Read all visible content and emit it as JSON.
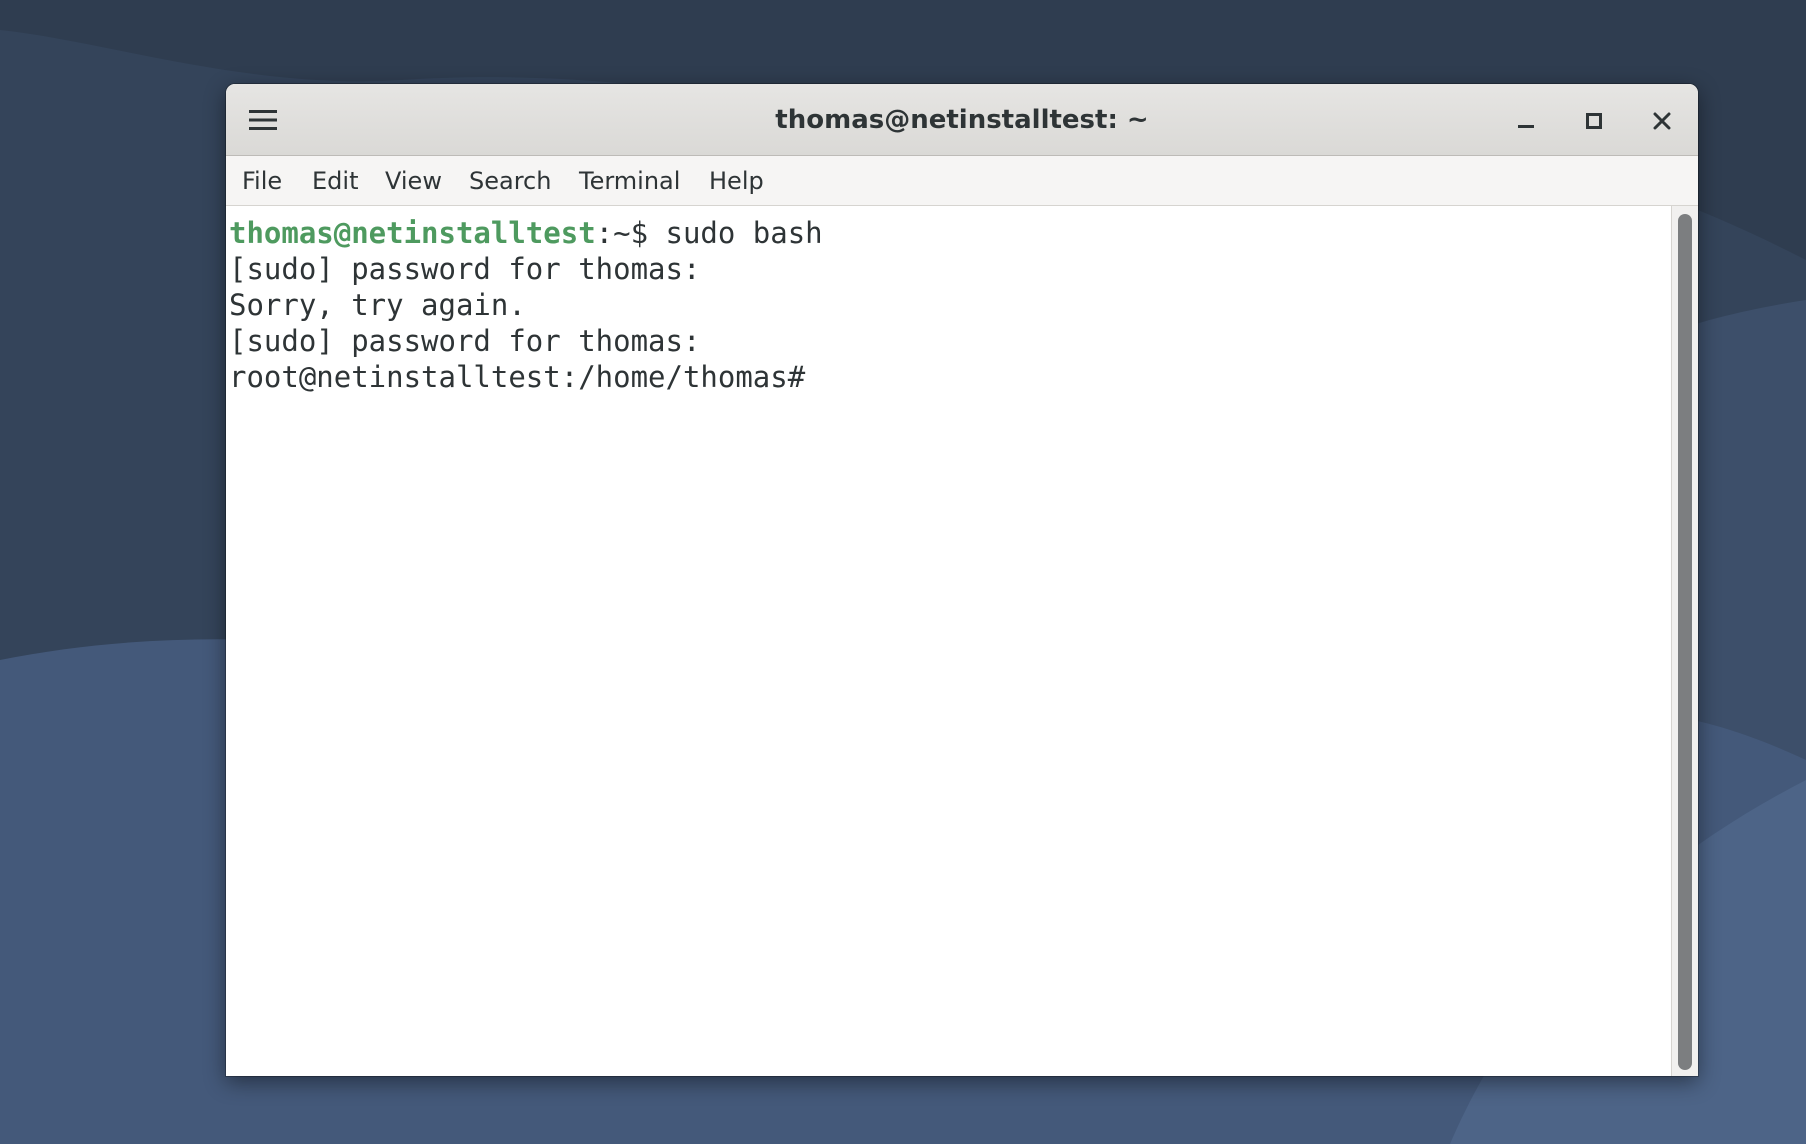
{
  "window": {
    "title": "thomas@netinstalltest: ~"
  },
  "menu": {
    "items": [
      "File",
      "Edit",
      "View",
      "Search",
      "Terminal",
      "Help"
    ]
  },
  "terminal": {
    "prompt_user_host": "thomas@netinstalltest",
    "prompt_suffix": ":~$ ",
    "command": "sudo bash",
    "lines": [
      "[sudo] password for thomas:",
      "Sorry, try again.",
      "[sudo] password for thomas:",
      "root@netinstalltest:/home/thomas#"
    ]
  },
  "colors": {
    "desktop_background": "#34445a",
    "prompt_user": "#4e9a5f",
    "scrollbar_thumb": "#7c7e80"
  },
  "icons": {
    "menu": "hamburger-icon",
    "minimize": "minimize-icon",
    "maximize": "maximize-icon",
    "close": "close-icon"
  }
}
